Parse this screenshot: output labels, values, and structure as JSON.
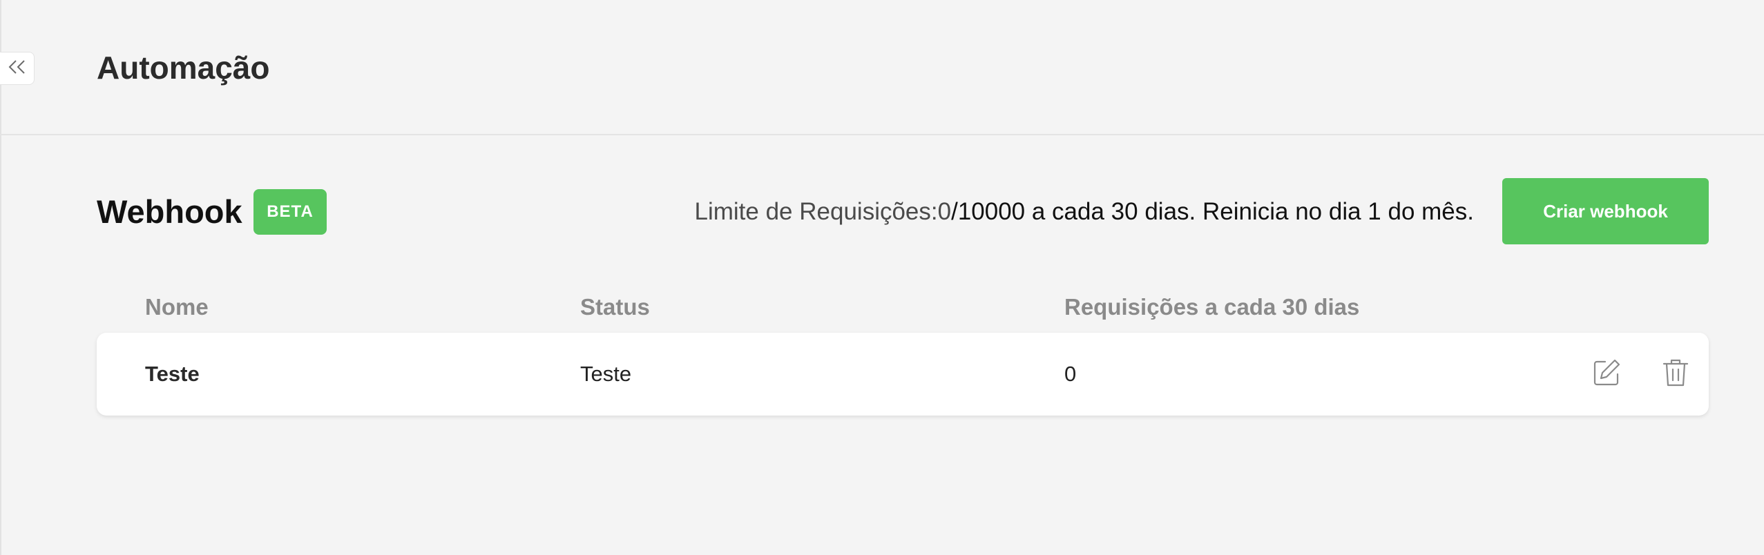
{
  "page": {
    "title": "Automação"
  },
  "sidebar_toggle": {
    "icon": "chevrons-left-icon"
  },
  "webhook_section": {
    "title": "Webhook",
    "badge": "BETA",
    "limit_label": "Limite de Requisições:",
    "limit_used": "0",
    "limit_rest": "/10000 a cada 30 dias. Reinicia no dia 1 do mês.",
    "create_button": "Criar webhook"
  },
  "table": {
    "columns": [
      "Nome",
      "Status",
      "Requisições a cada 30 dias"
    ],
    "rows": [
      {
        "name": "Teste",
        "status": "Teste",
        "requests": "0",
        "actions": [
          "edit-icon",
          "trash-icon"
        ]
      }
    ]
  },
  "colors": {
    "accent": "#57c55e",
    "background": "#f4f4f4",
    "header_text": "#8a8a8a"
  }
}
